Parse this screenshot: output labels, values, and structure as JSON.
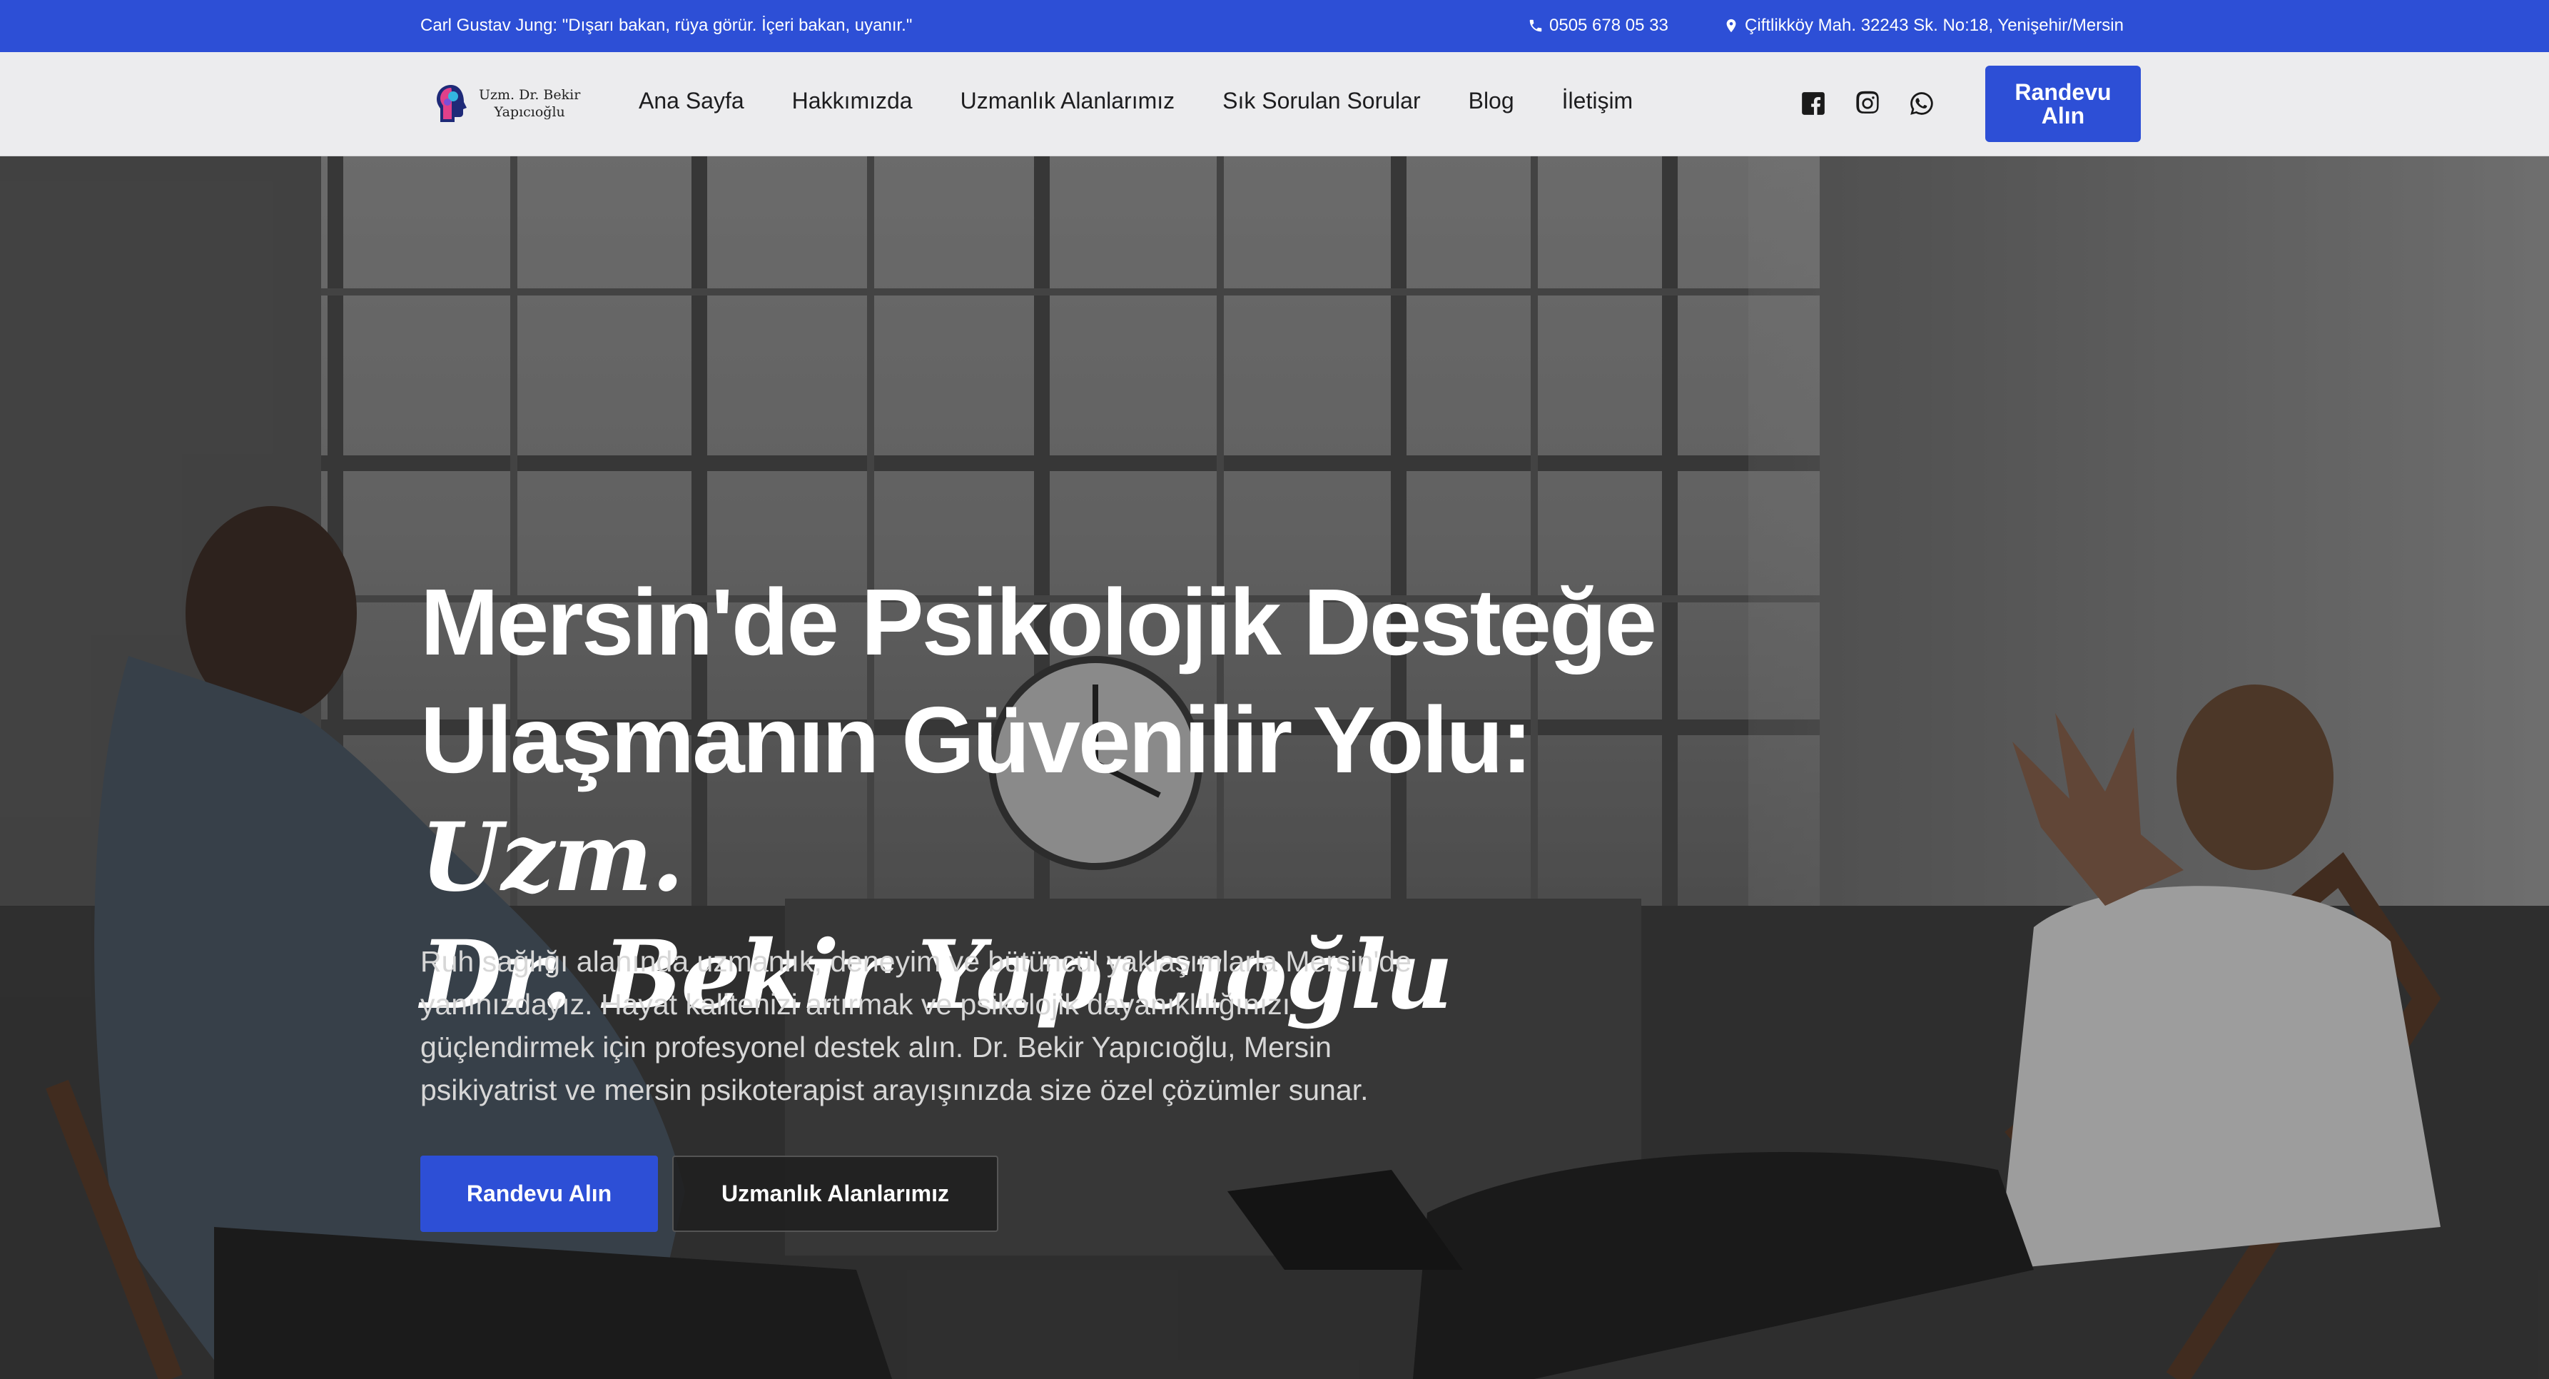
{
  "topbar": {
    "quote": "Carl Gustav Jung: \"Dışarı bakan, rüya görür. İçeri bakan, uyanır.\"",
    "phone": "0505 678 05 33",
    "address": "Çiftlikköy Mah. 32243 Sk. No:18, Yenişehir/Mersin"
  },
  "brand": {
    "line1": "Uzm. Dr. Bekir",
    "line2": "Yapıcıoğlu"
  },
  "nav": {
    "items": [
      "Ana Sayfa",
      "Hakkımızda",
      "Uzmanlık Alanlarımız",
      "Sık Sorulan Sorular",
      "Blog",
      "İletişim"
    ],
    "cta": "Randevu Alın"
  },
  "socials": [
    "facebook-icon",
    "instagram-icon",
    "whatsapp-icon"
  ],
  "hero": {
    "title_line1": "Mersin'de Psikolojik Desteğe",
    "title_line2": "Ulaşmanın Güvenilir Yolu: ",
    "title_em1": "Uzm.",
    "title_em2": "Dr. Bekir Yapıcıoğlu",
    "description": "Ruh sağlığı alanında uzmanlık, deneyim ve bütüncül yaklaşımlarla Mersin'de yanınızdayız. Hayat kalitenizi artırmak ve psikolojik dayanıklılığınızı güçlendirmek için profesyonel destek alın. Dr. Bekir Yapıcıoğlu, Mersin psikiyatrist ve mersin psikoterapist arayışınızda size özel çözümler sunar.",
    "primary_button": "Randevu Alın",
    "secondary_button": "Uzmanlık Alanlarımız"
  },
  "colors": {
    "accent": "#2d4fd6",
    "nav_bg": "#ececee",
    "text_dark": "#1d1d1f"
  }
}
